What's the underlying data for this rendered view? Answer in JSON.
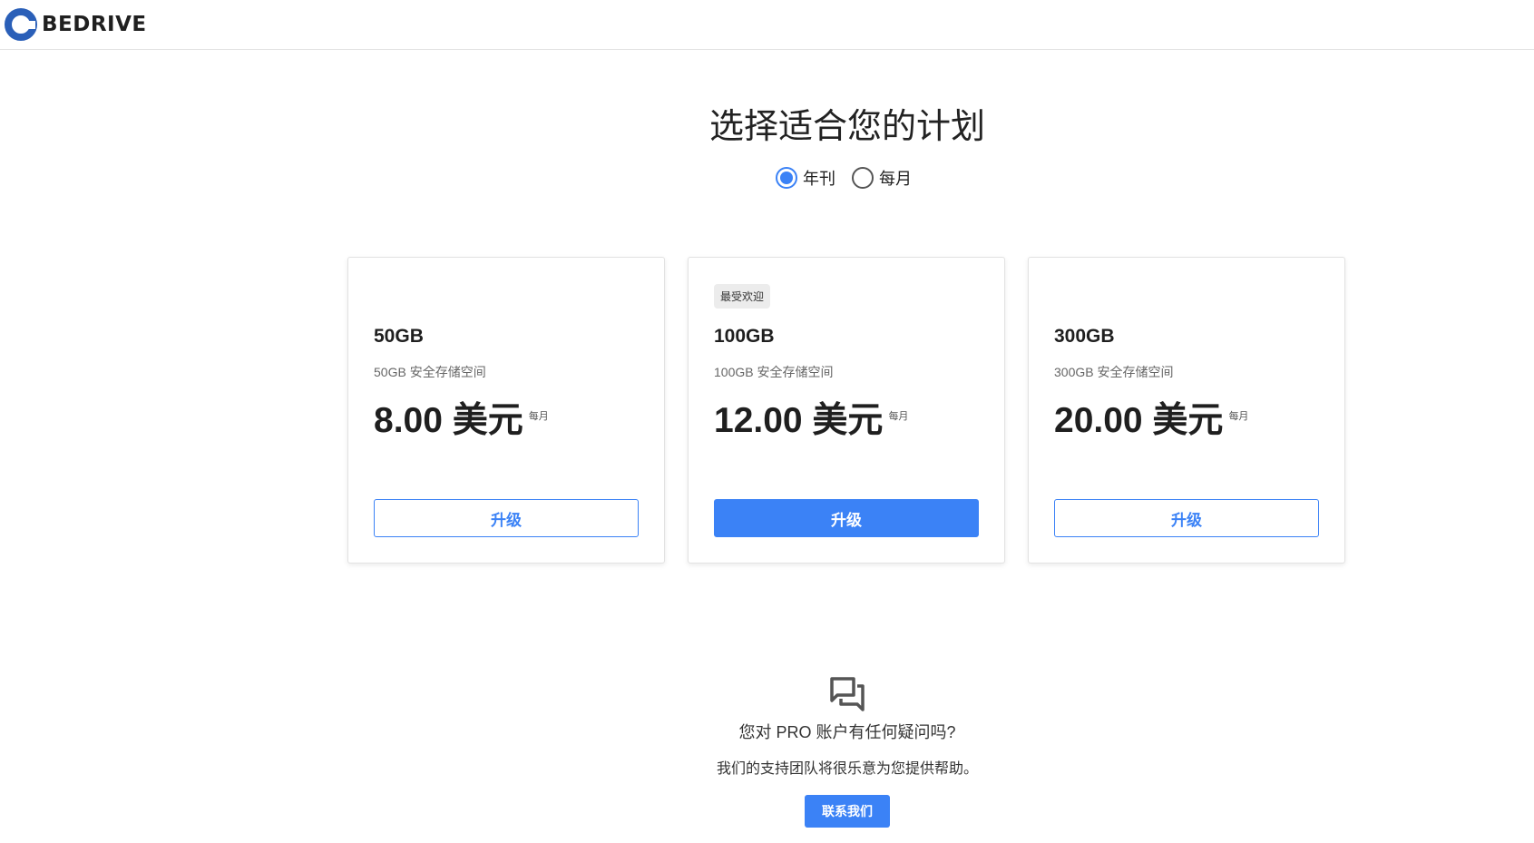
{
  "brand": {
    "name": "BEDRIVE",
    "accent": "#3b82f6"
  },
  "page": {
    "title": "选择适合您的计划"
  },
  "billing_cycle": {
    "options": [
      {
        "label": "年刊",
        "selected": true
      },
      {
        "label": "每月",
        "selected": false
      }
    ]
  },
  "plans": [
    {
      "badge": "",
      "name": "50GB",
      "description": "50GB 安全存储空间",
      "price": "8.00 美元",
      "period": "每月",
      "button": "升级",
      "primary": false
    },
    {
      "badge": "最受欢迎",
      "name": "100GB",
      "description": "100GB 安全存储空间",
      "price": "12.00 美元",
      "period": "每月",
      "button": "升级",
      "primary": true
    },
    {
      "badge": "",
      "name": "300GB",
      "description": "300GB 安全存储空间",
      "price": "20.00 美元",
      "period": "每月",
      "button": "升级",
      "primary": false
    }
  ],
  "help": {
    "icon": "chat-bubbles-icon",
    "title": "您对 PRO 账户有任何疑问吗?",
    "subtitle": "我们的支持团队将很乐意为您提供帮助。",
    "button": "联系我们"
  }
}
